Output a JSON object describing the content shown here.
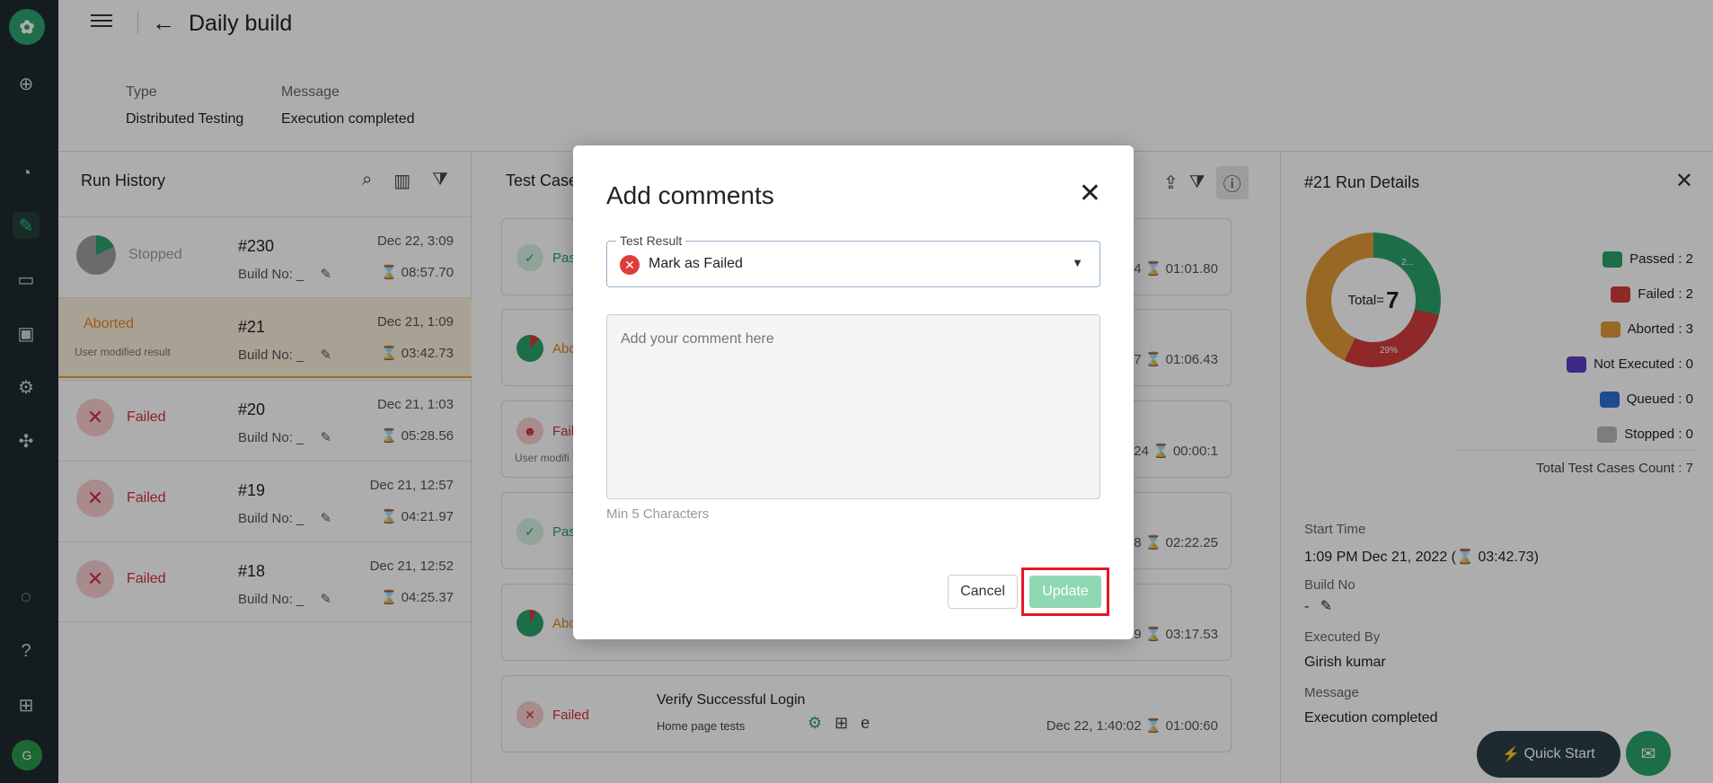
{
  "header": {
    "title": "Daily build",
    "type_label": "Type",
    "type_value": "Distributed Testing",
    "message_label": "Message",
    "message_value": "Execution completed"
  },
  "rail": {
    "avatar_initial": "G"
  },
  "run_history": {
    "title": "Run History",
    "items": [
      {
        "status": "Stopped",
        "sub": "",
        "number": "#230",
        "build": "Build No: _",
        "date": "Dec 22, 3:09",
        "duration": "08:57.70"
      },
      {
        "status": "Aborted",
        "sub": "User modified result",
        "number": "#21",
        "build": "Build No: _",
        "date": "Dec 21, 1:09",
        "duration": "03:42.73"
      },
      {
        "status": "Failed",
        "sub": "",
        "number": "#20",
        "build": "Build No: _",
        "date": "Dec 21, 1:03",
        "duration": "05:28.56"
      },
      {
        "status": "Failed",
        "sub": "",
        "number": "#19",
        "build": "Build No: _",
        "date": "Dec 21, 12:57",
        "duration": "04:21.97"
      },
      {
        "status": "Failed",
        "sub": "",
        "number": "#18",
        "build": "Build No: _",
        "date": "Dec 21, 12:52",
        "duration": "04:25.37"
      }
    ]
  },
  "test_cases": {
    "title": "Test Case",
    "cards": [
      {
        "status": "Pass",
        "sub": "",
        "right": "14 ⌛ 01:01.80"
      },
      {
        "status": "Abo",
        "sub": "",
        "right": "17 ⌛ 01:06.43"
      },
      {
        "status": "Faile",
        "sub": "User modifi",
        "right": "3:24 ⌛ 00:00:1"
      },
      {
        "status": "Pass",
        "sub": "",
        "right": "58 ⌛ 02:22.25"
      },
      {
        "status": "Abo",
        "sub": "",
        "right": "59 ⌛ 03:17.53"
      },
      {
        "status": "Failed",
        "sub": "",
        "name": "Verify Successful Login",
        "suite": "Home page tests",
        "right": "Dec 22, 1:40:02 ⌛ 01:00:60"
      }
    ]
  },
  "details": {
    "title": "#21 Run Details",
    "total_label": "Total=",
    "total_value": "7",
    "slice_label_passed": "2...",
    "slice_label_failed": "29%",
    "legend": [
      {
        "label": "Passed : 2",
        "color": "#2aa36b"
      },
      {
        "label": "Failed : 2",
        "color": "#d33b3b"
      },
      {
        "label": "Aborted : 3",
        "color": "#e09a35"
      },
      {
        "label": "Not Executed : 0",
        "color": "#5b3fc4"
      },
      {
        "label": "Queued : 0",
        "color": "#2f6fd1"
      },
      {
        "label": "Stopped : 0",
        "color": "#b8b8b8"
      }
    ],
    "total_count": "Total Test Cases Count : 7",
    "start_time_label": "Start Time",
    "start_time_value": "1:09 PM Dec 21, 2022  (⌛ 03:42.73)",
    "build_no_label": "Build No",
    "build_no_value": "-",
    "executed_by_label": "Executed By",
    "executed_by_value": "Girish kumar",
    "message_label": "Message",
    "message_value": "Execution completed",
    "quick_start": "Quick Start"
  },
  "modal": {
    "title": "Add comments",
    "field_label": "Test Result",
    "field_value": "Mark as Failed",
    "comment_placeholder": "Add your comment here",
    "hint": "Min 5 Characters",
    "cancel": "Cancel",
    "update": "Update"
  }
}
